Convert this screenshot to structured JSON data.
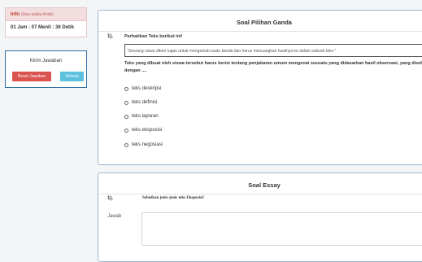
{
  "info": {
    "title": "Info",
    "subtitle": "(Sisa waktu Anda)",
    "timer": "01 Jam : 07 Menit : 36 Detik"
  },
  "kirim": {
    "title": "Kirim Jawaban",
    "reset_label": "Reset Jawaban",
    "selesai_label": "Selesai"
  },
  "pilihan_ganda": {
    "title": "Soal Pilihan Ganda",
    "number": "1).",
    "intro": "Perhatikan Teks berikut ini!",
    "quote": "\"Seorang siswa diberi tugas untuk mengamati suatu benda dan harus menuangkan hasilnya ke dalam sebuah teks \"",
    "question": "Teks yang dibuat oleh siswa tersebut harus berisi tentang penjabaran umum mengenai sesuatu yang didasarkan hasil observasi, yang disebut dengan ....",
    "options": [
      "teks deskripsi",
      "teks definisi",
      "teks laporan",
      "teks eksposisi",
      "teks negosiasi"
    ]
  },
  "essay": {
    "title": "Soal Essay",
    "number": "1).",
    "question": "Sebutkan jenis-jenis teks Eksposisi!",
    "jawab_label": "Jawab"
  }
}
